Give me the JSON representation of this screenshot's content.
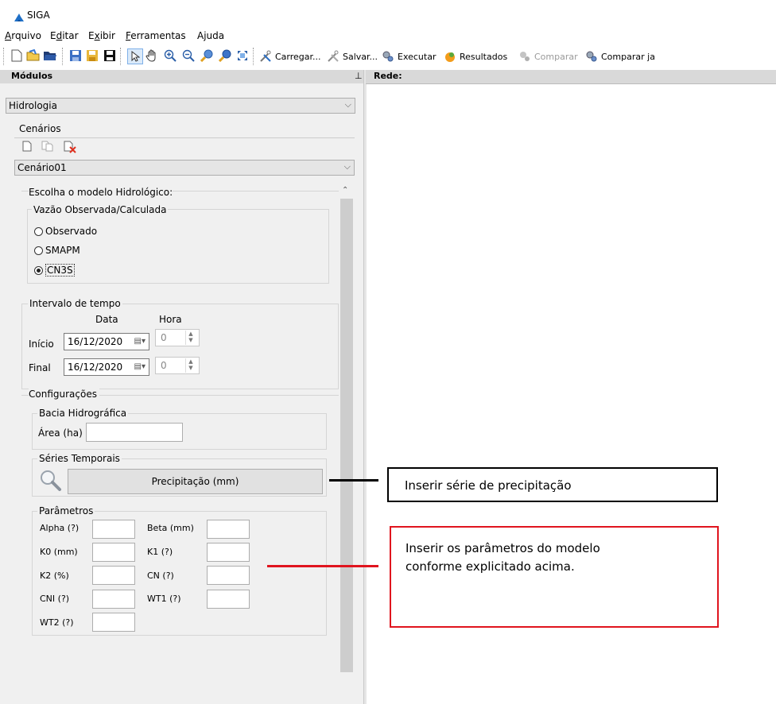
{
  "app": {
    "title": "SIGA"
  },
  "menu": {
    "items": [
      {
        "label": "Arquivo",
        "mn": "A"
      },
      {
        "label": "Editar",
        "mn": "d"
      },
      {
        "label": "Exibir",
        "mn": "x"
      },
      {
        "label": "Ferramentas",
        "mn": "F"
      },
      {
        "label": "Ajuda",
        "mn": ""
      }
    ]
  },
  "toolbar": {
    "carregar": "Carregar...",
    "salvar": "Salvar...",
    "executar": "Executar",
    "resultados": "Resultados",
    "comparar": "Comparar",
    "comparar_ja": "Comparar ja"
  },
  "left_panel": {
    "title": "Módulos",
    "module_select": "Hidrologia",
    "cenarios_label": "Cenários",
    "cenario_select": "Cenário01",
    "modelo": {
      "title": "Escolha o modelo Hidrológico:",
      "group_label": "Vazão Observada/Calculada",
      "options": [
        "Observado",
        "SMAPM",
        "CN3S"
      ],
      "selected": "CN3S"
    },
    "intervalo": {
      "title": "Intervalo de tempo",
      "col_data": "Data",
      "col_hora": "Hora",
      "inicio_label": "Início",
      "inicio_date": "16/12/2020",
      "inicio_hora": "0",
      "final_label": "Final",
      "final_date": "16/12/2020",
      "final_hora": "0"
    },
    "config": {
      "title": "Configurações",
      "bacia_label": "Bacia Hidrográfica",
      "area_label": "Área (ha)",
      "area_value": "",
      "series_label": "Séries Temporais",
      "precip_button": "Precipitação (mm)",
      "params_label": "Parâmetros",
      "params": {
        "alpha": "Alpha (?)",
        "beta": "Beta (mm)",
        "k0": "K0 (mm)",
        "k1": "K1 (?)",
        "k2": "K2 (%)",
        "cn": "CN (?)",
        "cni": "CNI (?)",
        "wt1": "WT1 (?)",
        "wt2": "WT2 (?)"
      }
    }
  },
  "right_panel": {
    "title": "Rede:"
  },
  "annotations": {
    "precip_callout": "Inserir série de precipitação",
    "params_callout_line1": "Inserir os parâmetros do modelo",
    "params_callout_line2": "conforme explicitado acima.",
    "colors": {
      "precip_border": "#000000",
      "params_border": "#e0141e"
    }
  }
}
